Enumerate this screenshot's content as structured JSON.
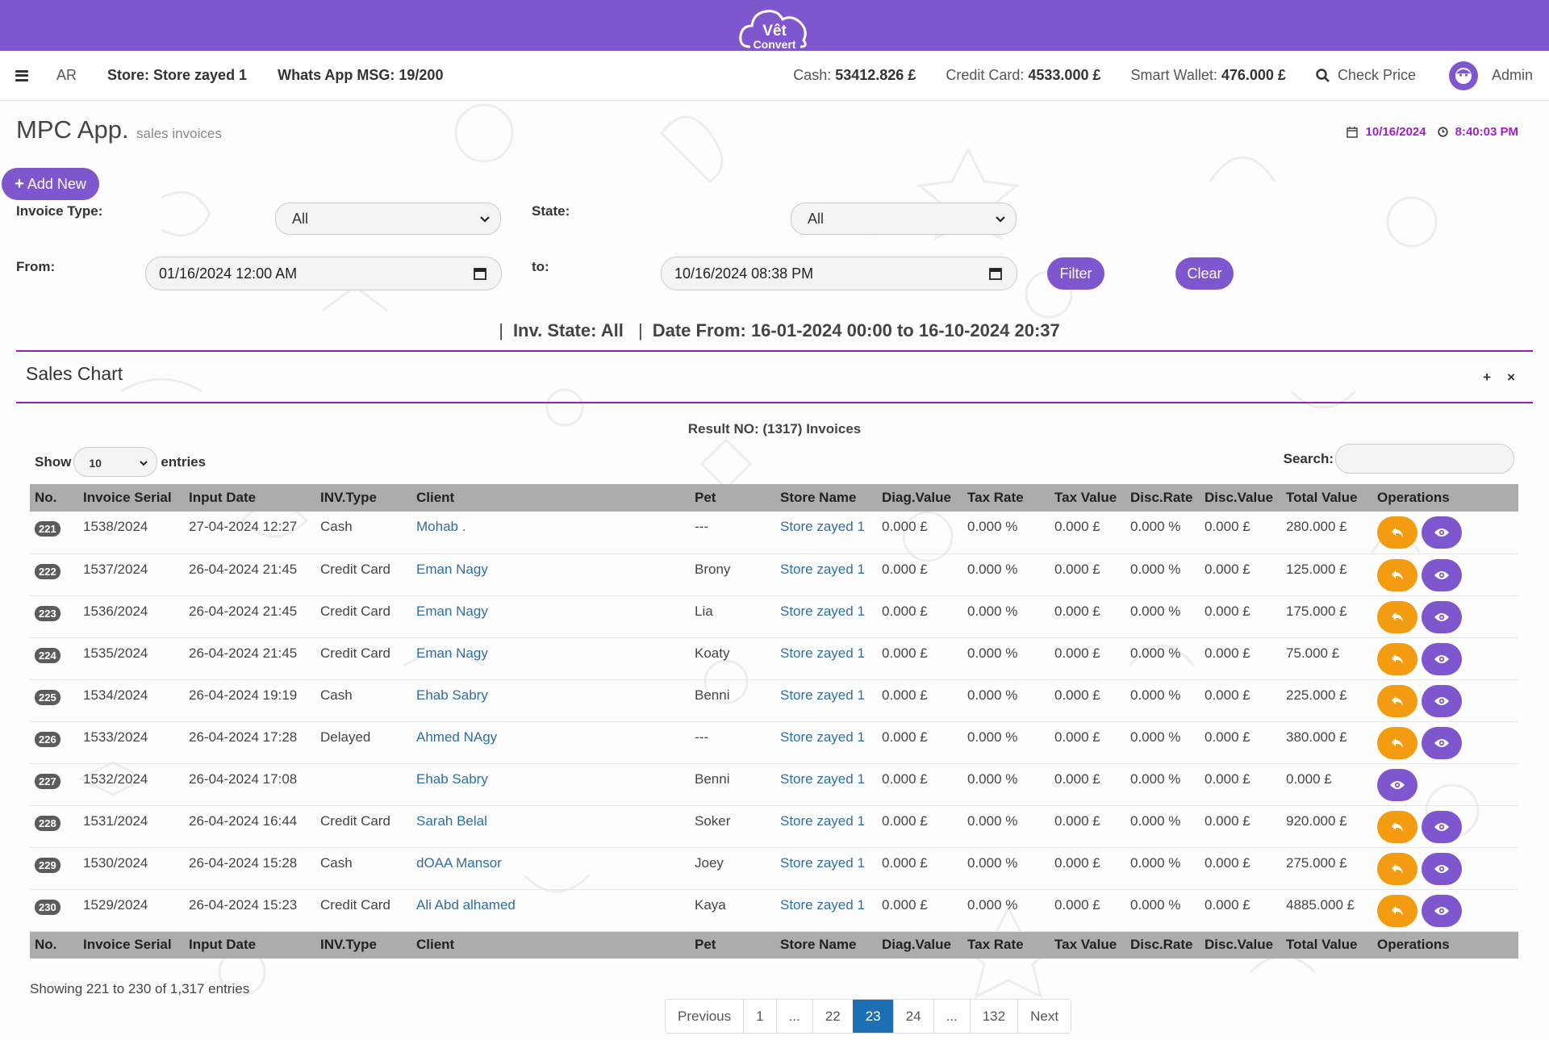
{
  "brand": {
    "line1": "Vêt",
    "line2": "Convert"
  },
  "nav": {
    "lang": "AR",
    "store": "Store: Store zayed 1",
    "whats": "Whats App MSG: 19/200",
    "cash_label": "Cash:",
    "cash_value": "53412.826 £",
    "cc_label": "Credit Card:",
    "cc_value": "4533.000 £",
    "wallet_label": "Smart Wallet:",
    "wallet_value": "476.000 £",
    "check_price": "Check Price",
    "user": "Admin"
  },
  "page": {
    "title": "MPC App.",
    "subtitle": "sales invoices",
    "date": "10/16/2024",
    "time": "8:40:03 PM"
  },
  "colors": {
    "primary": "#7e57cf",
    "orange": "#f39c12",
    "accent": "#a020c8",
    "link": "#2e6da4"
  },
  "filters": {
    "add_new": "Add New",
    "invoice_type_label": "Invoice Type:",
    "invoice_type_value": "All",
    "state_label": "State:",
    "state_value": "All",
    "from_label": "From:",
    "from_value": "01/16/2024 12:00 AM",
    "to_label": "to:",
    "to_value": "10/16/2024 08:38 PM",
    "filter_btn": "Filter",
    "clear_btn": "Clear"
  },
  "summary": {
    "sep": "|",
    "inv_state": "Inv. State: All",
    "date_range": "Date From: 16-01-2024 00:00 to 16-10-2024 20:37"
  },
  "chart": {
    "title": "Sales Chart",
    "expand": "+",
    "close": "×"
  },
  "table_meta": {
    "result": "Result NO: (1317) Invoices",
    "show_label": "Show",
    "entries_label": "entries",
    "page_length": "10",
    "search_label": "Search:",
    "showing": "Showing 221 to 230 of 1,317 entries"
  },
  "columns": [
    "No.",
    "Invoice Serial",
    "Input Date",
    "INV.Type",
    "Client",
    "Pet",
    "Store Name",
    "Diag.Value",
    "Tax Rate",
    "Tax Value",
    "Disc.Rate",
    "Disc.Value",
    "Total Value",
    "Operations"
  ],
  "rows": [
    {
      "no": "221",
      "serial": "1538/2024",
      "date": "27-04-2024 12:27",
      "type": "Cash",
      "client": "Mohab .",
      "pet": "---",
      "store": "Store zayed 1",
      "diag": "0.000 £",
      "tax_rate": "0.000 %",
      "tax_value": "0.000 £",
      "disc_rate": "0.000 %",
      "disc_value": "0.000 £",
      "total": "280.000 £",
      "ret": true
    },
    {
      "no": "222",
      "serial": "1537/2024",
      "date": "26-04-2024 21:45",
      "type": "Credit Card",
      "client": "Eman Nagy",
      "pet": "Brony",
      "store": "Store zayed 1",
      "diag": "0.000 £",
      "tax_rate": "0.000 %",
      "tax_value": "0.000 £",
      "disc_rate": "0.000 %",
      "disc_value": "0.000 £",
      "total": "125.000 £",
      "ret": true
    },
    {
      "no": "223",
      "serial": "1536/2024",
      "date": "26-04-2024 21:45",
      "type": "Credit Card",
      "client": "Eman Nagy",
      "pet": "Lia",
      "store": "Store zayed 1",
      "diag": "0.000 £",
      "tax_rate": "0.000 %",
      "tax_value": "0.000 £",
      "disc_rate": "0.000 %",
      "disc_value": "0.000 £",
      "total": "175.000 £",
      "ret": true
    },
    {
      "no": "224",
      "serial": "1535/2024",
      "date": "26-04-2024 21:45",
      "type": "Credit Card",
      "client": "Eman Nagy",
      "pet": "Koaty",
      "store": "Store zayed 1",
      "diag": "0.000 £",
      "tax_rate": "0.000 %",
      "tax_value": "0.000 £",
      "disc_rate": "0.000 %",
      "disc_value": "0.000 £",
      "total": "75.000 £",
      "ret": true
    },
    {
      "no": "225",
      "serial": "1534/2024",
      "date": "26-04-2024 19:19",
      "type": "Cash",
      "client": "Ehab Sabry",
      "pet": "Benni",
      "store": "Store zayed 1",
      "diag": "0.000 £",
      "tax_rate": "0.000 %",
      "tax_value": "0.000 £",
      "disc_rate": "0.000 %",
      "disc_value": "0.000 £",
      "total": "225.000 £",
      "ret": true
    },
    {
      "no": "226",
      "serial": "1533/2024",
      "date": "26-04-2024 17:28",
      "type": "Delayed",
      "client": "Ahmed NAgy",
      "pet": "---",
      "store": "Store zayed 1",
      "diag": "0.000 £",
      "tax_rate": "0.000 %",
      "tax_value": "0.000 £",
      "disc_rate": "0.000 %",
      "disc_value": "0.000 £",
      "total": "380.000 £",
      "ret": true
    },
    {
      "no": "227",
      "serial": "1532/2024",
      "date": "26-04-2024 17:08",
      "type": "",
      "client": "Ehab Sabry",
      "pet": "Benni",
      "store": "Store zayed 1",
      "diag": "0.000 £",
      "tax_rate": "0.000 %",
      "tax_value": "0.000 £",
      "disc_rate": "0.000 %",
      "disc_value": "0.000 £",
      "total": "0.000 £",
      "ret": false
    },
    {
      "no": "228",
      "serial": "1531/2024",
      "date": "26-04-2024 16:44",
      "type": "Credit Card",
      "client": "Sarah Belal",
      "pet": "Soker",
      "store": "Store zayed 1",
      "diag": "0.000 £",
      "tax_rate": "0.000 %",
      "tax_value": "0.000 £",
      "disc_rate": "0.000 %",
      "disc_value": "0.000 £",
      "total": "920.000 £",
      "ret": true
    },
    {
      "no": "229",
      "serial": "1530/2024",
      "date": "26-04-2024 15:28",
      "type": "Cash",
      "client": "dOAA Mansor",
      "pet": "Joey",
      "store": "Store zayed 1",
      "diag": "0.000 £",
      "tax_rate": "0.000 %",
      "tax_value": "0.000 £",
      "disc_rate": "0.000 %",
      "disc_value": "0.000 £",
      "total": "275.000 £",
      "ret": true
    },
    {
      "no": "230",
      "serial": "1529/2024",
      "date": "26-04-2024 15:23",
      "type": "Credit Card",
      "client": "Ali Abd alhamed",
      "pet": "Kaya",
      "store": "Store zayed 1",
      "diag": "0.000 £",
      "tax_rate": "0.000 %",
      "tax_value": "0.000 £",
      "disc_rate": "0.000 %",
      "disc_value": "0.000 £",
      "total": "4885.000 £",
      "ret": true
    }
  ],
  "pagination": [
    {
      "label": "Previous",
      "active": false
    },
    {
      "label": "1",
      "active": false
    },
    {
      "label": "...",
      "active": false
    },
    {
      "label": "22",
      "active": false
    },
    {
      "label": "23",
      "active": true
    },
    {
      "label": "24",
      "active": false
    },
    {
      "label": "...",
      "active": false
    },
    {
      "label": "132",
      "active": false
    },
    {
      "label": "Next",
      "active": false
    }
  ]
}
